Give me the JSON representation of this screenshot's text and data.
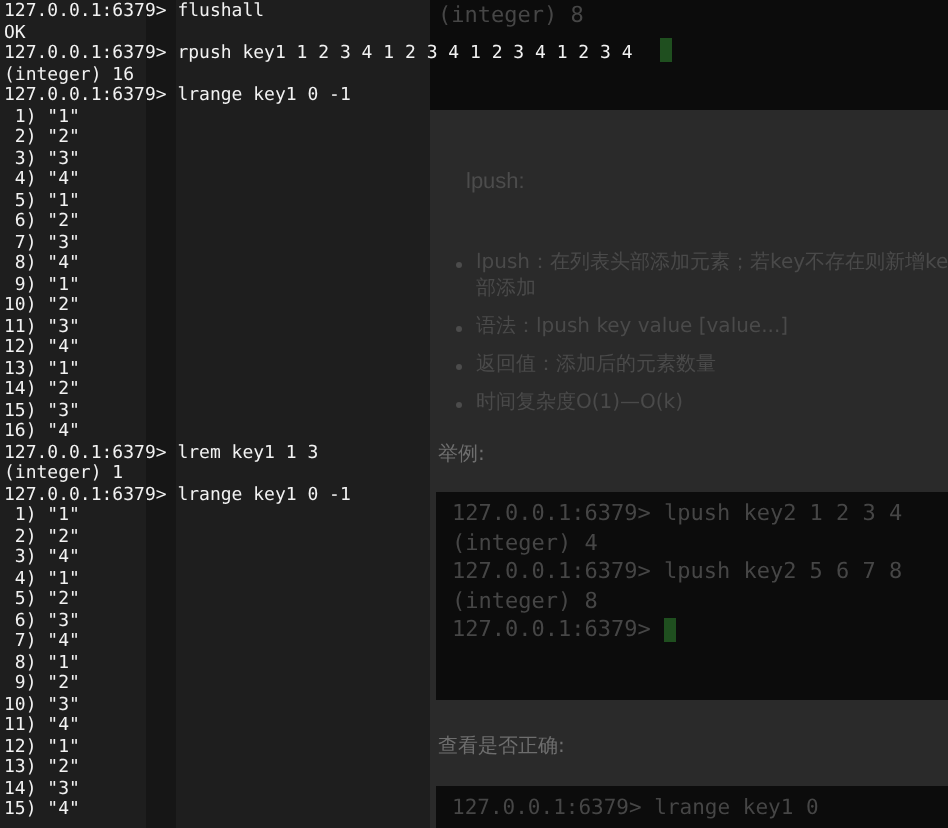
{
  "terminal": {
    "lines": [
      "127.0.0.1:6379> flushall",
      "OK",
      "127.0.0.1:6379> rpush key1 1 2 3 4 1 2 3 4 1 2 3 4 1 2 3 4",
      "(integer) 16",
      "127.0.0.1:6379> lrange key1 0 -1",
      " 1) \"1\"",
      " 2) \"2\"",
      " 3) \"3\"",
      " 4) \"4\"",
      " 5) \"1\"",
      " 6) \"2\"",
      " 7) \"3\"",
      " 8) \"4\"",
      " 9) \"1\"",
      "10) \"2\"",
      "11) \"3\"",
      "12) \"4\"",
      "13) \"1\"",
      "14) \"2\"",
      "15) \"3\"",
      "16) \"4\"",
      "127.0.0.1:6379> lrem key1 1 3",
      "(integer) 1",
      "127.0.0.1:6379> lrange key1 0 -1",
      " 1) \"1\"",
      " 2) \"2\"",
      " 3) \"4\"",
      " 4) \"1\"",
      " 5) \"2\"",
      " 6) \"3\"",
      " 7) \"4\"",
      " 8) \"1\"",
      " 9) \"2\"",
      "10) \"3\"",
      "11) \"4\"",
      "12) \"1\"",
      "13) \"2\"",
      "14) \"3\"",
      "15) \"4\""
    ]
  },
  "page": {
    "top_code": {
      "lines": [
        "(integer) 8"
      ],
      "cursor_row": true
    },
    "heading": "lpush:",
    "bullets": [
      {
        "lines": [
          "lpush：在列表头部添加元素；若key不存在则新增ke",
          "部添加"
        ]
      },
      {
        "lines": [
          "语法：lpush key value [value...]"
        ]
      },
      {
        "lines": [
          "返回值：添加后的元素数量"
        ]
      },
      {
        "lines": [
          "时间复杂度O(1)—O(k)"
        ]
      }
    ],
    "example_label": "举例:",
    "example_code": {
      "lines": [
        "127.0.0.1:6379> lpush key2 1 2 3 4",
        "(integer) 4",
        "127.0.0.1:6379> lpush key2 5 6 7 8",
        "(integer) 8",
        "127.0.0.1:6379> "
      ],
      "cursor": true
    },
    "check_label": "查看是否正确:",
    "bottom_code": {
      "lines": [
        "127.0.0.1:6379> lrange key1 0"
      ]
    }
  }
}
